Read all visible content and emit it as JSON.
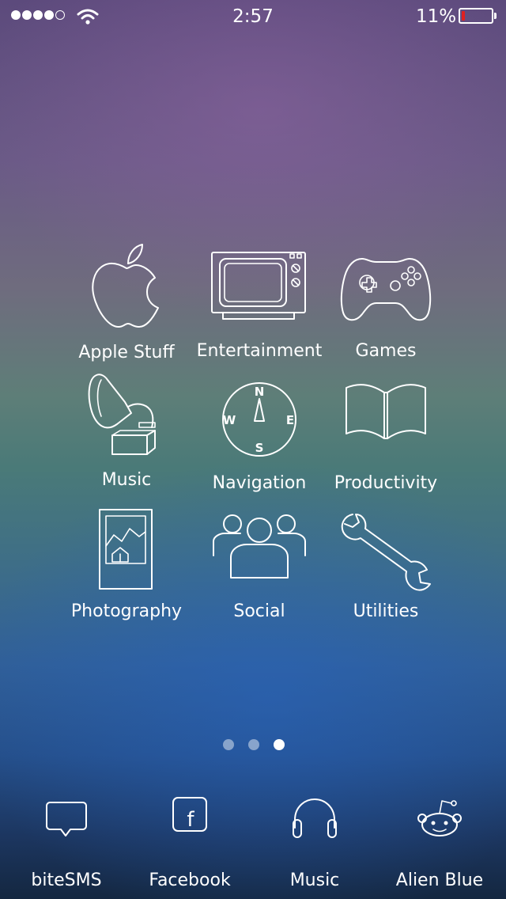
{
  "status_bar": {
    "signal_bars_filled": 4,
    "signal_bars_total": 5,
    "time": "2:57",
    "battery_percent_text": "11%",
    "battery_level": 0.11,
    "battery_color": "#e02020"
  },
  "folders": [
    {
      "label": "Apple Stuff",
      "icon": "apple-icon"
    },
    {
      "label": "Entertainment",
      "icon": "tv-icon"
    },
    {
      "label": "Games",
      "icon": "game-controller-icon"
    },
    {
      "label": "Music",
      "icon": "gramophone-icon"
    },
    {
      "label": "Navigation",
      "icon": "compass-icon"
    },
    {
      "label": "Productivity",
      "icon": "book-icon"
    },
    {
      "label": "Photography",
      "icon": "photo-frame-icon"
    },
    {
      "label": "Social",
      "icon": "people-icon"
    },
    {
      "label": "Utilities",
      "icon": "wrench-icon"
    }
  ],
  "compass": {
    "n": "N",
    "s": "S",
    "e": "E",
    "w": "W"
  },
  "page_indicator": {
    "pages": 3,
    "current": 3
  },
  "dock": [
    {
      "label": "biteSMS",
      "icon": "message-bubble-icon"
    },
    {
      "label": "Facebook",
      "icon": "facebook-icon",
      "glyph": "f"
    },
    {
      "label": "Music",
      "icon": "headphones-icon"
    },
    {
      "label": "Alien Blue",
      "icon": "reddit-alien-icon"
    }
  ]
}
